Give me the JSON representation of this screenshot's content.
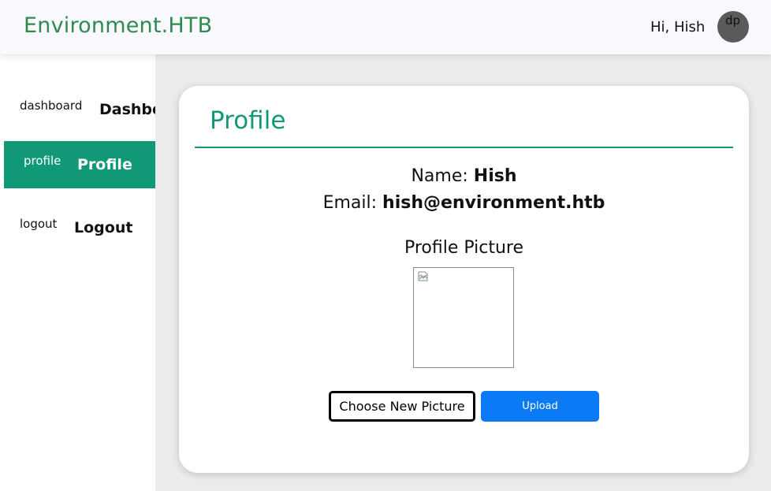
{
  "header": {
    "brand": "Environment.HTB",
    "greeting": "Hi, Hish",
    "avatar_alt": "dp",
    "brand_color": "#2e8b4f"
  },
  "sidebar": {
    "items": [
      {
        "icon_text": "dashboard",
        "label": "Dashboard",
        "active": false
      },
      {
        "icon_text": "profile",
        "label": "Profile",
        "active": true
      },
      {
        "icon_text": "logout",
        "label": "Logout",
        "active": false
      }
    ],
    "active_color": "#119977"
  },
  "profile": {
    "title": "Profile",
    "name_label": "Name:",
    "name_value": "Hish",
    "email_label": "Email:",
    "email_value": "hish@environment.htb",
    "picture_heading": "Profile Picture",
    "picture_icon": "broken-image-icon",
    "choose_label": "Choose New Picture",
    "upload_label": "Upload",
    "upload_color": "#0a7bf5"
  }
}
